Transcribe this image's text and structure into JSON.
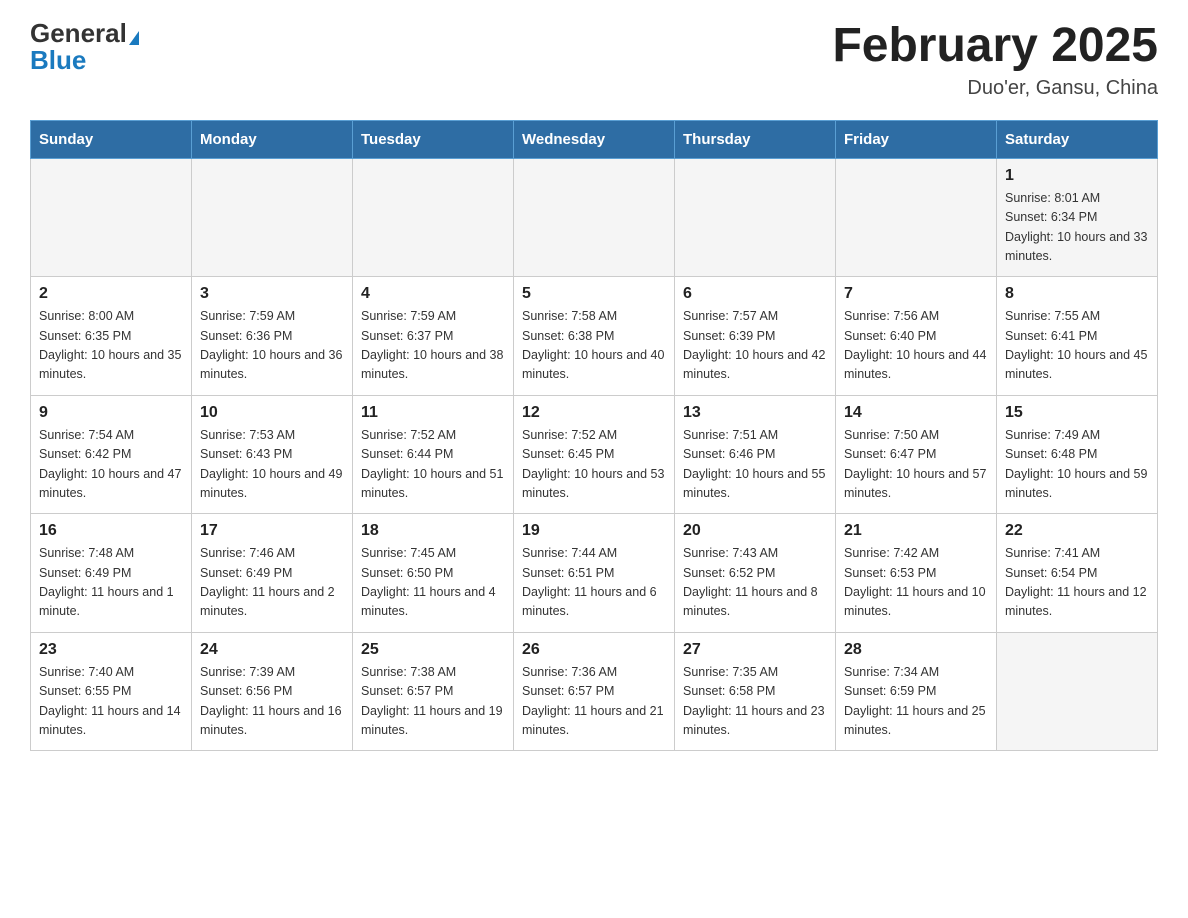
{
  "header": {
    "logo_general": "General",
    "logo_blue": "Blue",
    "month_title": "February 2025",
    "location": "Duo'er, Gansu, China"
  },
  "weekdays": [
    "Sunday",
    "Monday",
    "Tuesday",
    "Wednesday",
    "Thursday",
    "Friday",
    "Saturday"
  ],
  "weeks": [
    [
      {
        "day": "",
        "sunrise": "",
        "sunset": "",
        "daylight": ""
      },
      {
        "day": "",
        "sunrise": "",
        "sunset": "",
        "daylight": ""
      },
      {
        "day": "",
        "sunrise": "",
        "sunset": "",
        "daylight": ""
      },
      {
        "day": "",
        "sunrise": "",
        "sunset": "",
        "daylight": ""
      },
      {
        "day": "",
        "sunrise": "",
        "sunset": "",
        "daylight": ""
      },
      {
        "day": "",
        "sunrise": "",
        "sunset": "",
        "daylight": ""
      },
      {
        "day": "1",
        "sunrise": "Sunrise: 8:01 AM",
        "sunset": "Sunset: 6:34 PM",
        "daylight": "Daylight: 10 hours and 33 minutes."
      }
    ],
    [
      {
        "day": "2",
        "sunrise": "Sunrise: 8:00 AM",
        "sunset": "Sunset: 6:35 PM",
        "daylight": "Daylight: 10 hours and 35 minutes."
      },
      {
        "day": "3",
        "sunrise": "Sunrise: 7:59 AM",
        "sunset": "Sunset: 6:36 PM",
        "daylight": "Daylight: 10 hours and 36 minutes."
      },
      {
        "day": "4",
        "sunrise": "Sunrise: 7:59 AM",
        "sunset": "Sunset: 6:37 PM",
        "daylight": "Daylight: 10 hours and 38 minutes."
      },
      {
        "day": "5",
        "sunrise": "Sunrise: 7:58 AM",
        "sunset": "Sunset: 6:38 PM",
        "daylight": "Daylight: 10 hours and 40 minutes."
      },
      {
        "day": "6",
        "sunrise": "Sunrise: 7:57 AM",
        "sunset": "Sunset: 6:39 PM",
        "daylight": "Daylight: 10 hours and 42 minutes."
      },
      {
        "day": "7",
        "sunrise": "Sunrise: 7:56 AM",
        "sunset": "Sunset: 6:40 PM",
        "daylight": "Daylight: 10 hours and 44 minutes."
      },
      {
        "day": "8",
        "sunrise": "Sunrise: 7:55 AM",
        "sunset": "Sunset: 6:41 PM",
        "daylight": "Daylight: 10 hours and 45 minutes."
      }
    ],
    [
      {
        "day": "9",
        "sunrise": "Sunrise: 7:54 AM",
        "sunset": "Sunset: 6:42 PM",
        "daylight": "Daylight: 10 hours and 47 minutes."
      },
      {
        "day": "10",
        "sunrise": "Sunrise: 7:53 AM",
        "sunset": "Sunset: 6:43 PM",
        "daylight": "Daylight: 10 hours and 49 minutes."
      },
      {
        "day": "11",
        "sunrise": "Sunrise: 7:52 AM",
        "sunset": "Sunset: 6:44 PM",
        "daylight": "Daylight: 10 hours and 51 minutes."
      },
      {
        "day": "12",
        "sunrise": "Sunrise: 7:52 AM",
        "sunset": "Sunset: 6:45 PM",
        "daylight": "Daylight: 10 hours and 53 minutes."
      },
      {
        "day": "13",
        "sunrise": "Sunrise: 7:51 AM",
        "sunset": "Sunset: 6:46 PM",
        "daylight": "Daylight: 10 hours and 55 minutes."
      },
      {
        "day": "14",
        "sunrise": "Sunrise: 7:50 AM",
        "sunset": "Sunset: 6:47 PM",
        "daylight": "Daylight: 10 hours and 57 minutes."
      },
      {
        "day": "15",
        "sunrise": "Sunrise: 7:49 AM",
        "sunset": "Sunset: 6:48 PM",
        "daylight": "Daylight: 10 hours and 59 minutes."
      }
    ],
    [
      {
        "day": "16",
        "sunrise": "Sunrise: 7:48 AM",
        "sunset": "Sunset: 6:49 PM",
        "daylight": "Daylight: 11 hours and 1 minute."
      },
      {
        "day": "17",
        "sunrise": "Sunrise: 7:46 AM",
        "sunset": "Sunset: 6:49 PM",
        "daylight": "Daylight: 11 hours and 2 minutes."
      },
      {
        "day": "18",
        "sunrise": "Sunrise: 7:45 AM",
        "sunset": "Sunset: 6:50 PM",
        "daylight": "Daylight: 11 hours and 4 minutes."
      },
      {
        "day": "19",
        "sunrise": "Sunrise: 7:44 AM",
        "sunset": "Sunset: 6:51 PM",
        "daylight": "Daylight: 11 hours and 6 minutes."
      },
      {
        "day": "20",
        "sunrise": "Sunrise: 7:43 AM",
        "sunset": "Sunset: 6:52 PM",
        "daylight": "Daylight: 11 hours and 8 minutes."
      },
      {
        "day": "21",
        "sunrise": "Sunrise: 7:42 AM",
        "sunset": "Sunset: 6:53 PM",
        "daylight": "Daylight: 11 hours and 10 minutes."
      },
      {
        "day": "22",
        "sunrise": "Sunrise: 7:41 AM",
        "sunset": "Sunset: 6:54 PM",
        "daylight": "Daylight: 11 hours and 12 minutes."
      }
    ],
    [
      {
        "day": "23",
        "sunrise": "Sunrise: 7:40 AM",
        "sunset": "Sunset: 6:55 PM",
        "daylight": "Daylight: 11 hours and 14 minutes."
      },
      {
        "day": "24",
        "sunrise": "Sunrise: 7:39 AM",
        "sunset": "Sunset: 6:56 PM",
        "daylight": "Daylight: 11 hours and 16 minutes."
      },
      {
        "day": "25",
        "sunrise": "Sunrise: 7:38 AM",
        "sunset": "Sunset: 6:57 PM",
        "daylight": "Daylight: 11 hours and 19 minutes."
      },
      {
        "day": "26",
        "sunrise": "Sunrise: 7:36 AM",
        "sunset": "Sunset: 6:57 PM",
        "daylight": "Daylight: 11 hours and 21 minutes."
      },
      {
        "day": "27",
        "sunrise": "Sunrise: 7:35 AM",
        "sunset": "Sunset: 6:58 PM",
        "daylight": "Daylight: 11 hours and 23 minutes."
      },
      {
        "day": "28",
        "sunrise": "Sunrise: 7:34 AM",
        "sunset": "Sunset: 6:59 PM",
        "daylight": "Daylight: 11 hours and 25 minutes."
      },
      {
        "day": "",
        "sunrise": "",
        "sunset": "",
        "daylight": ""
      }
    ]
  ]
}
